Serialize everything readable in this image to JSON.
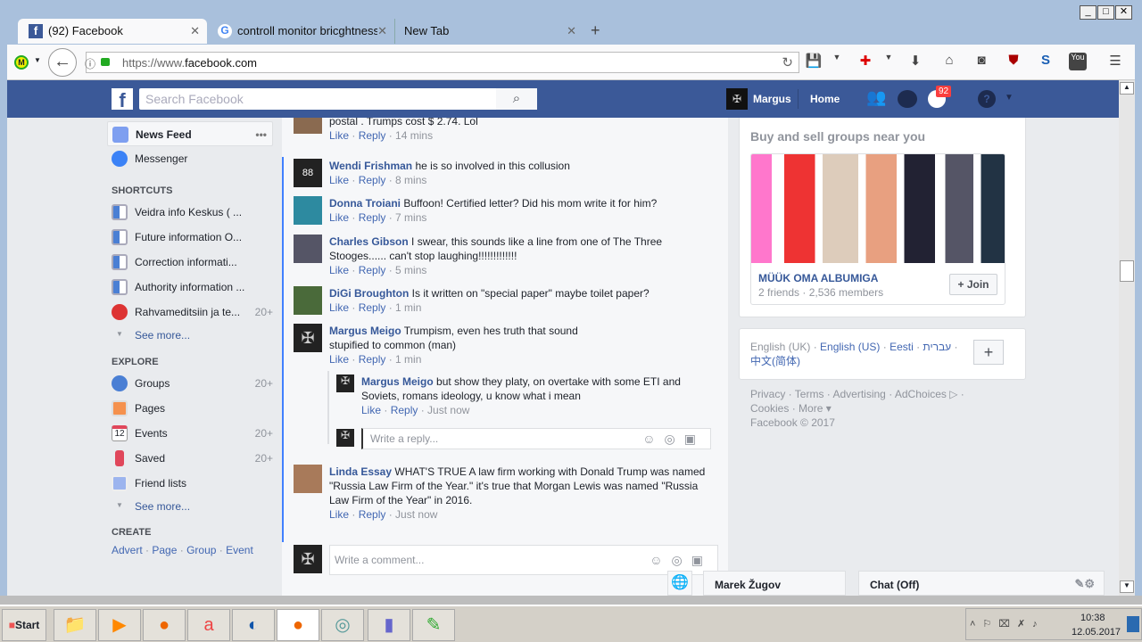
{
  "browser": {
    "tabs": [
      {
        "label": "(92) Facebook"
      },
      {
        "label": "controll monitor bricghtness"
      },
      {
        "label": "New Tab"
      }
    ],
    "url_prefix": "https://www.",
    "url_domain": "facebook.com",
    "win_buttons": [
      "_",
      "□",
      "✕"
    ]
  },
  "fb": {
    "search_placeholder": "Search Facebook",
    "user": "Margus",
    "home": "Home",
    "notif_count": "92"
  },
  "left_nav": {
    "top": [
      {
        "label": "News Feed"
      },
      {
        "label": "Messenger"
      }
    ],
    "shortcuts_title": "SHORTCUTS",
    "shortcuts": [
      {
        "label": "Veidra info Keskus ( ..."
      },
      {
        "label": "Future information O..."
      },
      {
        "label": "Correction informati..."
      },
      {
        "label": "Authority information ..."
      },
      {
        "label": "Rahvameditsiin ja te...",
        "count": "20+"
      }
    ],
    "see_more": "See more...",
    "explore_title": "EXPLORE",
    "explore": [
      {
        "label": "Groups",
        "count": "20+"
      },
      {
        "label": "Pages"
      },
      {
        "label": "Events",
        "count": "20+"
      },
      {
        "label": "Saved",
        "count": "20+"
      },
      {
        "label": "Friend lists"
      }
    ],
    "create_title": "CREATE",
    "create": [
      "Advert",
      "Page",
      "Group",
      "Event"
    ]
  },
  "comments": [
    {
      "name": "",
      "text": "postal . Trumps cost $ 2.74. Lol",
      "time": "14 mins"
    },
    {
      "name": "Wendi Frishman",
      "text": "he is so involved in this collusion",
      "time": "8 mins"
    },
    {
      "name": "Donna Troiani",
      "text": "Buffoon! Certified letter? Did his mom write it for him?",
      "time": "7 mins"
    },
    {
      "name": "Charles Gibson",
      "text": "I swear, this sounds like a line from one of The Three Stooges...... can't stop laughing!!!!!!!!!!!!!",
      "time": "5 mins"
    },
    {
      "name": "DiGi Broughton",
      "text": "Is it written on \"special paper\" maybe toilet paper?",
      "time": "1 min"
    },
    {
      "name": "Margus Meigo",
      "text": "Trumpism, even hes truth that sound stupified to common (man)",
      "time": "1 min"
    },
    {
      "name": "Margus Meigo",
      "text": "but show they platy, on overtake with some ETI and Soviets, romans ideology, u know what i mean",
      "time": "Just now"
    },
    {
      "name": "Linda Essay",
      "text": "WHAT'S TRUE A law firm working with Donald Trump was named \"Russia Law Firm of the Year.\" it's true that Morgan Lewis was named \"Russia Law Firm of the Year\" in 2016.",
      "time": "Just now"
    }
  ],
  "actions": {
    "like": "Like",
    "reply": "Reply"
  },
  "reply_placeholder": "Write a reply...",
  "comment_placeholder": "Write a comment...",
  "right": {
    "groups_title": "Buy and sell groups near you",
    "group_name": "MÜÜK OMA ALBUMIGA",
    "group_meta": "2 friends · 2,536 members",
    "join": "+ Join",
    "languages": [
      "English (UK)",
      "English (US)",
      "Eesti",
      "עברית",
      "中文(简体)"
    ],
    "footer": [
      "Privacy",
      "Terms",
      "Advertising",
      "AdChoices",
      "Cookies",
      "More"
    ],
    "copyright": "Facebook © 2017"
  },
  "chat": {
    "contact": "Marek Žugov",
    "status": "Chat (Off)"
  },
  "taskbar": {
    "start": "Start",
    "time": "10:38",
    "date": "12.05.2017"
  }
}
